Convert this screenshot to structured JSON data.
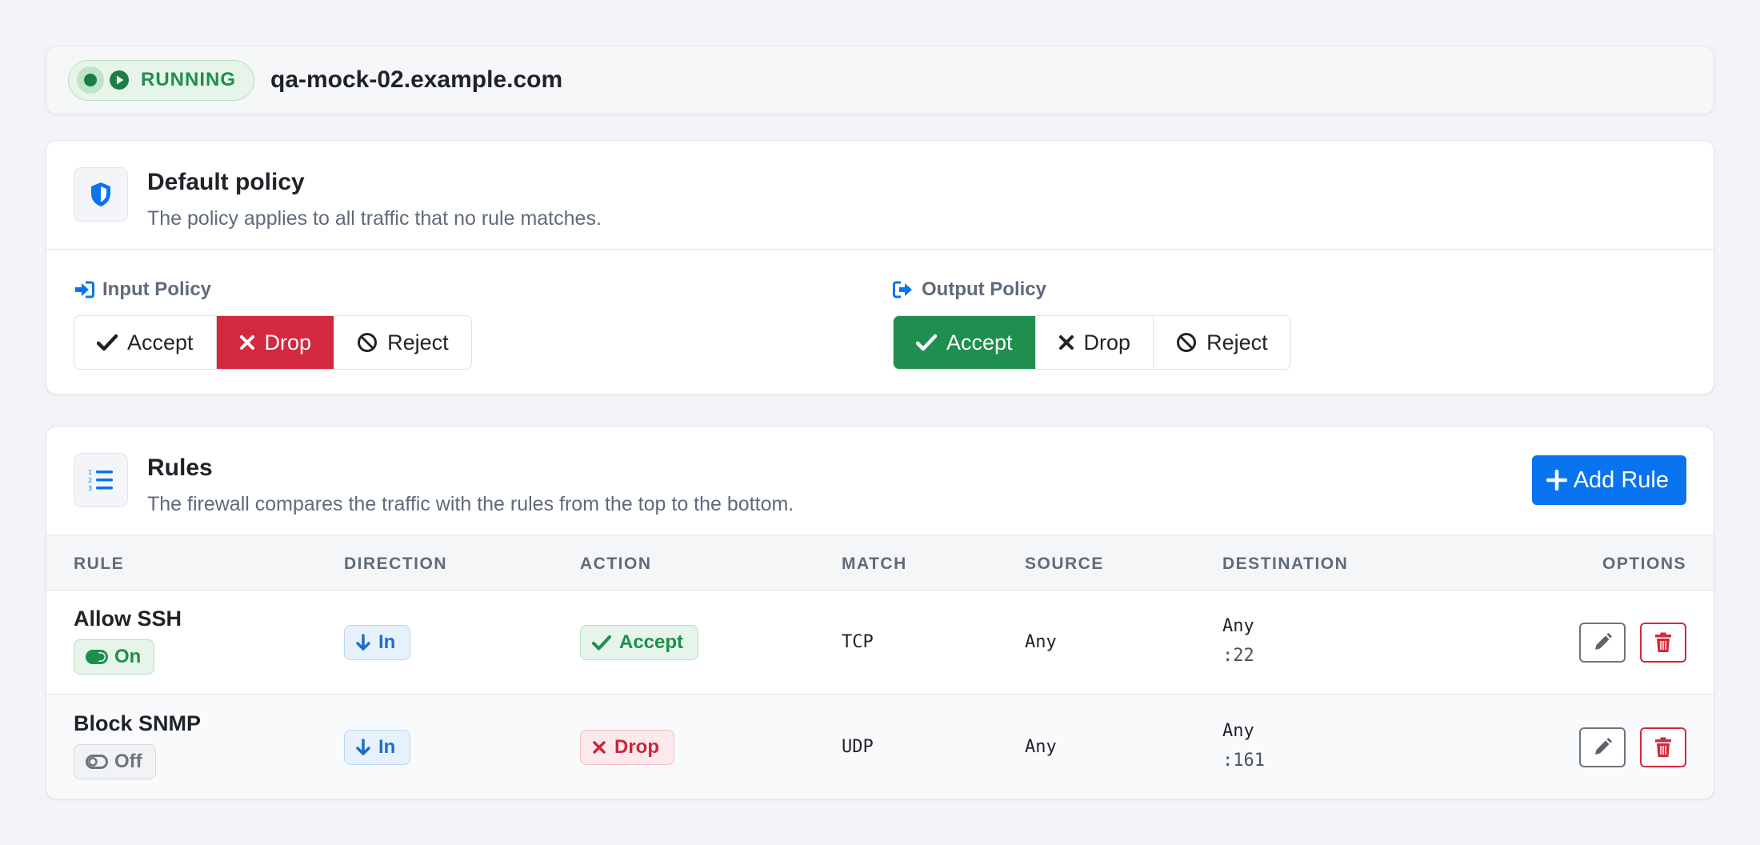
{
  "header": {
    "status": "RUNNING",
    "hostname": "qa-mock-02.example.com"
  },
  "policy": {
    "title": "Default policy",
    "subtitle": "The policy applies to all traffic that no rule matches.",
    "input": {
      "label": "Input Policy",
      "accept": "Accept",
      "drop": "Drop",
      "reject": "Reject",
      "selected": "Drop"
    },
    "output": {
      "label": "Output Policy",
      "accept": "Accept",
      "drop": "Drop",
      "reject": "Reject",
      "selected": "Accept"
    }
  },
  "rules": {
    "title": "Rules",
    "subtitle": "The firewall compares the traffic with the rules from the top to the bottom.",
    "add_label": "Add Rule",
    "columns": {
      "rule": "RULE",
      "direction": "DIRECTION",
      "action": "ACTION",
      "match": "MATCH",
      "source": "SOURCE",
      "destination": "DESTINATION",
      "options": "OPTIONS"
    },
    "rows": [
      {
        "name": "Allow SSH",
        "state": "On",
        "direction": "In",
        "action": "Accept",
        "match": "TCP",
        "source": "Any",
        "destination": "Any",
        "port": ":22"
      },
      {
        "name": "Block SNMP",
        "state": "Off",
        "direction": "In",
        "action": "Drop",
        "match": "UDP",
        "source": "Any",
        "destination": "Any",
        "port": ":161"
      }
    ]
  },
  "colors": {
    "accent": "#0a74f0",
    "success": "#1f8f4f",
    "danger": "#d3293e",
    "muted": "#5f6b7a"
  },
  "icons": {
    "status": "play-icon",
    "policy": "shield-icon",
    "input": "sign-in-icon",
    "output": "sign-out-icon",
    "rules": "ordered-list-icon",
    "add": "plus-icon",
    "edit": "pencil-icon",
    "delete": "trash-icon"
  }
}
